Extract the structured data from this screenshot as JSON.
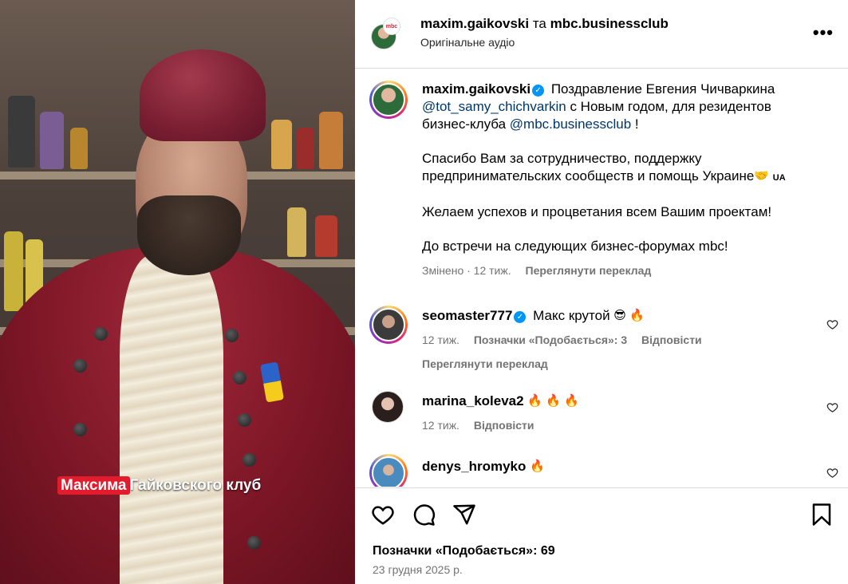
{
  "media": {
    "caption_highlight": "Максима",
    "caption_rest": "Гайковского клуб"
  },
  "header": {
    "author": "maxim.gaikovski",
    "connector": "та",
    "collaborator": "mbc.businessclub",
    "audio": "Оригінальне аудіо",
    "more_icon": "more-options-icon",
    "badge_text": "mbc"
  },
  "post": {
    "author": "maxim.gaikovski",
    "line1": "Поздравление Евгения Чичваркина",
    "mention1": "@tot_samy_chichvarkin",
    "line2": " с Новым годом, для резидентов бизнес-клуба ",
    "mention2": "@mbc.businessclub",
    "line2_end": " !",
    "para2": "Спасибо Вам за сотрудничество, поддержку предпринимательских сообществ и помощь Украине",
    "para2_flag": "UA",
    "para3": "Желаем успехов и процветания всем Вашим проектам!",
    "para4": "До встречи на следующих бизнес-форумах mbc!",
    "edited": "Змінено · 12 тиж.",
    "translate": "Переглянути переклад"
  },
  "comments": [
    {
      "user": "seomaster777",
      "text": "Макс крутой",
      "emojis": "😎 🔥",
      "time": "12 тиж.",
      "likes": "Позначки «Подобається»: 3",
      "reply": "Відповісти",
      "translate": "Переглянути переклад"
    },
    {
      "user": "marina_koleva2",
      "text": "",
      "emojis": "🔥 🔥 🔥",
      "time": "12 тиж.",
      "reply": "Відповісти"
    },
    {
      "user": "denys_hromyko",
      "text": "",
      "emojis": "🔥"
    }
  ],
  "footer": {
    "likes": "Позначки «Подобається»: 69",
    "date": "23 грудня 2025 р."
  },
  "colors": {
    "verified": "#0095f6",
    "link": "#00376b",
    "muted": "#737373"
  }
}
